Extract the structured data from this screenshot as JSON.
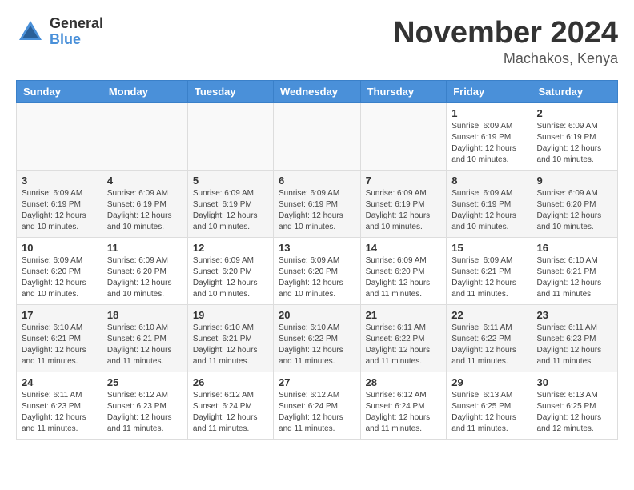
{
  "logo": {
    "general": "General",
    "blue": "Blue"
  },
  "header": {
    "month": "November 2024",
    "location": "Machakos, Kenya"
  },
  "days_of_week": [
    "Sunday",
    "Monday",
    "Tuesday",
    "Wednesday",
    "Thursday",
    "Friday",
    "Saturday"
  ],
  "weeks": [
    [
      {
        "day": "",
        "info": ""
      },
      {
        "day": "",
        "info": ""
      },
      {
        "day": "",
        "info": ""
      },
      {
        "day": "",
        "info": ""
      },
      {
        "day": "",
        "info": ""
      },
      {
        "day": "1",
        "info": "Sunrise: 6:09 AM\nSunset: 6:19 PM\nDaylight: 12 hours and 10 minutes."
      },
      {
        "day": "2",
        "info": "Sunrise: 6:09 AM\nSunset: 6:19 PM\nDaylight: 12 hours and 10 minutes."
      }
    ],
    [
      {
        "day": "3",
        "info": "Sunrise: 6:09 AM\nSunset: 6:19 PM\nDaylight: 12 hours and 10 minutes."
      },
      {
        "day": "4",
        "info": "Sunrise: 6:09 AM\nSunset: 6:19 PM\nDaylight: 12 hours and 10 minutes."
      },
      {
        "day": "5",
        "info": "Sunrise: 6:09 AM\nSunset: 6:19 PM\nDaylight: 12 hours and 10 minutes."
      },
      {
        "day": "6",
        "info": "Sunrise: 6:09 AM\nSunset: 6:19 PM\nDaylight: 12 hours and 10 minutes."
      },
      {
        "day": "7",
        "info": "Sunrise: 6:09 AM\nSunset: 6:19 PM\nDaylight: 12 hours and 10 minutes."
      },
      {
        "day": "8",
        "info": "Sunrise: 6:09 AM\nSunset: 6:19 PM\nDaylight: 12 hours and 10 minutes."
      },
      {
        "day": "9",
        "info": "Sunrise: 6:09 AM\nSunset: 6:20 PM\nDaylight: 12 hours and 10 minutes."
      }
    ],
    [
      {
        "day": "10",
        "info": "Sunrise: 6:09 AM\nSunset: 6:20 PM\nDaylight: 12 hours and 10 minutes."
      },
      {
        "day": "11",
        "info": "Sunrise: 6:09 AM\nSunset: 6:20 PM\nDaylight: 12 hours and 10 minutes."
      },
      {
        "day": "12",
        "info": "Sunrise: 6:09 AM\nSunset: 6:20 PM\nDaylight: 12 hours and 10 minutes."
      },
      {
        "day": "13",
        "info": "Sunrise: 6:09 AM\nSunset: 6:20 PM\nDaylight: 12 hours and 10 minutes."
      },
      {
        "day": "14",
        "info": "Sunrise: 6:09 AM\nSunset: 6:20 PM\nDaylight: 12 hours and 11 minutes."
      },
      {
        "day": "15",
        "info": "Sunrise: 6:09 AM\nSunset: 6:21 PM\nDaylight: 12 hours and 11 minutes."
      },
      {
        "day": "16",
        "info": "Sunrise: 6:10 AM\nSunset: 6:21 PM\nDaylight: 12 hours and 11 minutes."
      }
    ],
    [
      {
        "day": "17",
        "info": "Sunrise: 6:10 AM\nSunset: 6:21 PM\nDaylight: 12 hours and 11 minutes."
      },
      {
        "day": "18",
        "info": "Sunrise: 6:10 AM\nSunset: 6:21 PM\nDaylight: 12 hours and 11 minutes."
      },
      {
        "day": "19",
        "info": "Sunrise: 6:10 AM\nSunset: 6:21 PM\nDaylight: 12 hours and 11 minutes."
      },
      {
        "day": "20",
        "info": "Sunrise: 6:10 AM\nSunset: 6:22 PM\nDaylight: 12 hours and 11 minutes."
      },
      {
        "day": "21",
        "info": "Sunrise: 6:11 AM\nSunset: 6:22 PM\nDaylight: 12 hours and 11 minutes."
      },
      {
        "day": "22",
        "info": "Sunrise: 6:11 AM\nSunset: 6:22 PM\nDaylight: 12 hours and 11 minutes."
      },
      {
        "day": "23",
        "info": "Sunrise: 6:11 AM\nSunset: 6:23 PM\nDaylight: 12 hours and 11 minutes."
      }
    ],
    [
      {
        "day": "24",
        "info": "Sunrise: 6:11 AM\nSunset: 6:23 PM\nDaylight: 12 hours and 11 minutes."
      },
      {
        "day": "25",
        "info": "Sunrise: 6:12 AM\nSunset: 6:23 PM\nDaylight: 12 hours and 11 minutes."
      },
      {
        "day": "26",
        "info": "Sunrise: 6:12 AM\nSunset: 6:24 PM\nDaylight: 12 hours and 11 minutes."
      },
      {
        "day": "27",
        "info": "Sunrise: 6:12 AM\nSunset: 6:24 PM\nDaylight: 12 hours and 11 minutes."
      },
      {
        "day": "28",
        "info": "Sunrise: 6:12 AM\nSunset: 6:24 PM\nDaylight: 12 hours and 11 minutes."
      },
      {
        "day": "29",
        "info": "Sunrise: 6:13 AM\nSunset: 6:25 PM\nDaylight: 12 hours and 11 minutes."
      },
      {
        "day": "30",
        "info": "Sunrise: 6:13 AM\nSunset: 6:25 PM\nDaylight: 12 hours and 12 minutes."
      }
    ]
  ]
}
